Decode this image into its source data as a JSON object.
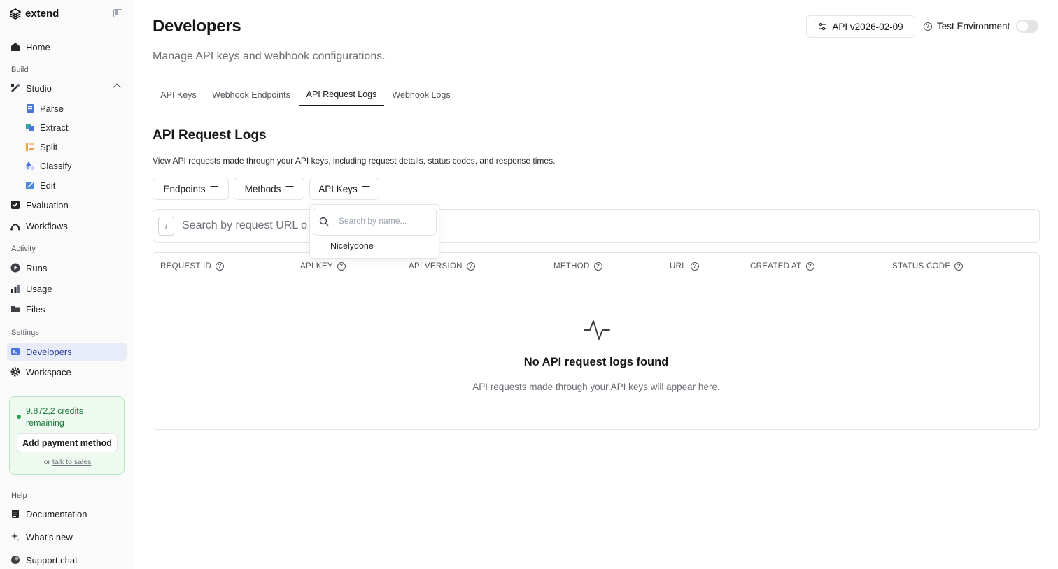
{
  "sidebar": {
    "brand": "extend",
    "items": {
      "home": "Home",
      "studio": "Studio",
      "parse": "Parse",
      "extract": "Extract",
      "split": "Split",
      "classify": "Classify",
      "edit": "Edit",
      "evaluation": "Evaluation",
      "workflows": "Workflows",
      "runs": "Runs",
      "usage": "Usage",
      "files": "Files",
      "developers": "Developers",
      "workspace": "Workspace",
      "documentation": "Documentation",
      "whats_new": "What's new",
      "support_chat": "Support chat"
    },
    "sections": {
      "build": "Build",
      "activity": "Activity",
      "settings": "Settings",
      "help": "Help"
    },
    "credits": {
      "text": "9.872,2 credits remaining",
      "button": "Add payment method",
      "or": "or",
      "sales_link": "talk to sales"
    }
  },
  "header": {
    "title": "Developers",
    "subtitle": "Manage API keys and webhook configurations.",
    "api_version": "API v2026-02-09",
    "environment_label": "Test Environment",
    "environment_on": false
  },
  "tabs": [
    "API Keys",
    "Webhook Endpoints",
    "API Request Logs",
    "Webhook Logs"
  ],
  "active_tab": "API Request Logs",
  "section": {
    "title": "API Request Logs",
    "description": "View API requests made through your API keys, including request details, status codes, and response times."
  },
  "filters": {
    "endpoints": "Endpoints",
    "methods": "Methods",
    "api_keys": "API Keys"
  },
  "search": {
    "shortcut": "/",
    "placeholder": "Search by request URL o"
  },
  "table": {
    "columns": [
      "REQUEST ID",
      "API KEY",
      "API VERSION",
      "METHOD",
      "URL",
      "CREATED AT",
      "STATUS CODE"
    ],
    "empty_title": "No API request logs found",
    "empty_subtitle": "API requests made through your API keys will appear here."
  },
  "dropdown": {
    "search_placeholder": "Search by name...",
    "options": [
      "Nicelydone"
    ]
  },
  "colors": {
    "accent_active": "#27399a",
    "credits_green": "#1d7a3a"
  }
}
